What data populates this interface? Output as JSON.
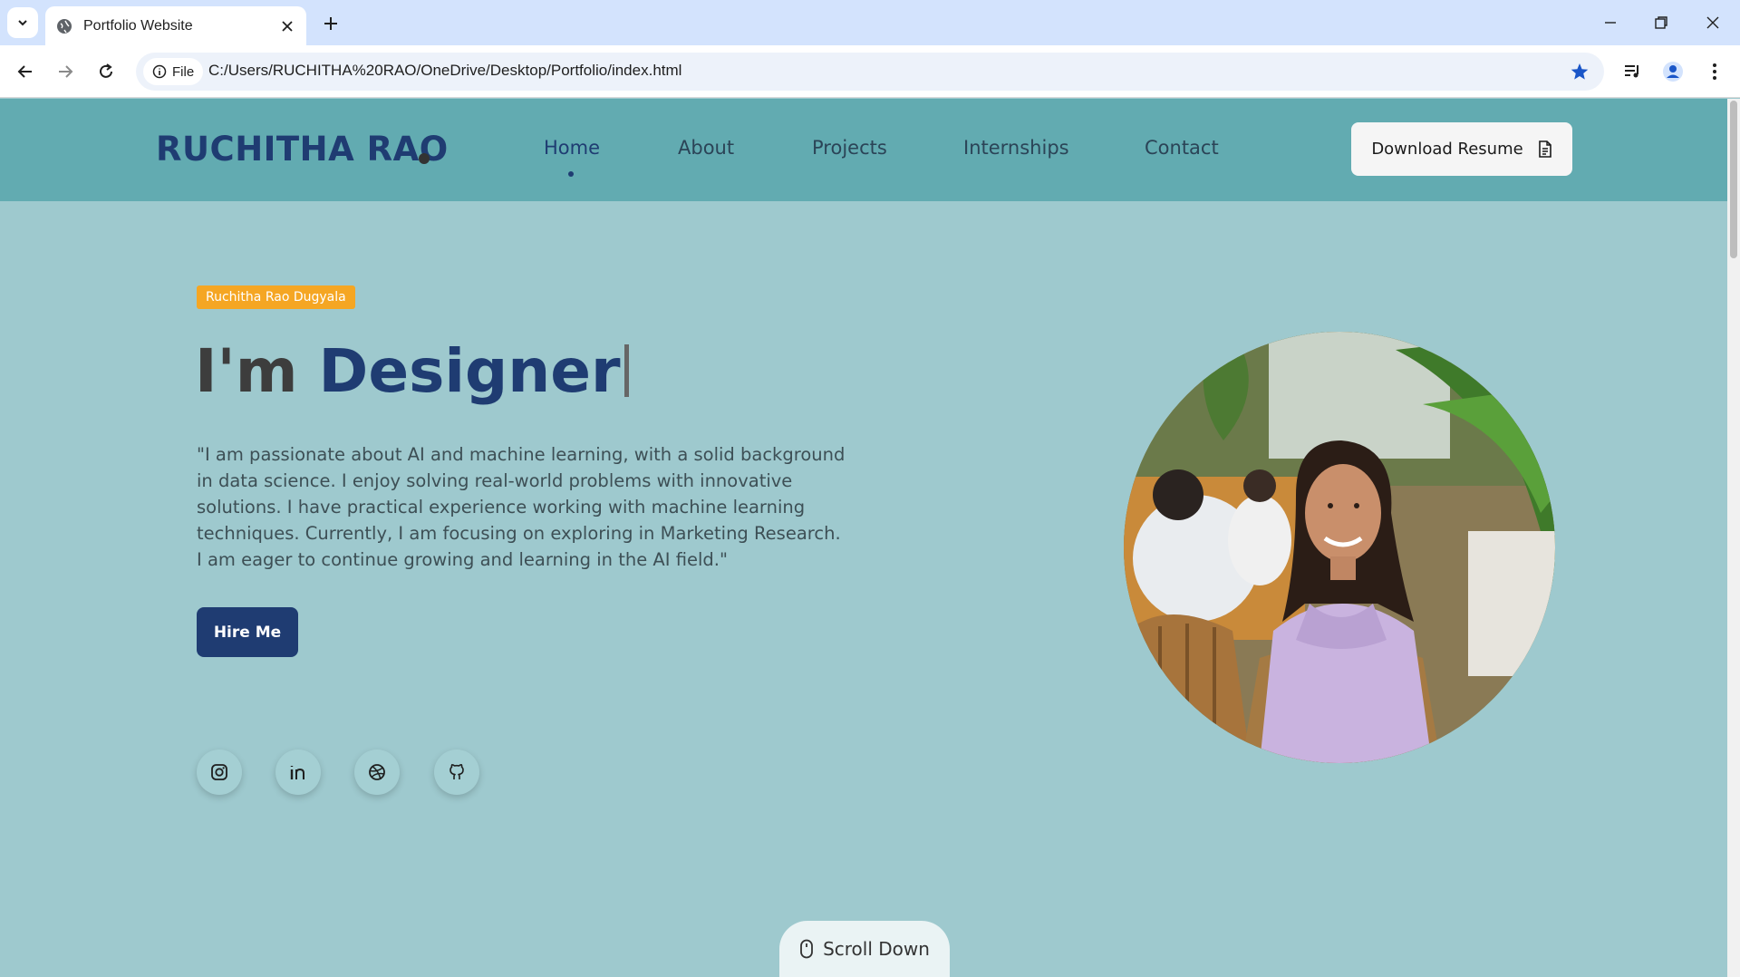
{
  "browser": {
    "tab_title": "Portfolio Website",
    "chip_label": "File",
    "url": "C:/Users/RUCHITHA%20RAO/OneDrive/Desktop/Portfolio/index.html"
  },
  "header": {
    "logo": "RUCHITHA RAO",
    "nav": [
      "Home",
      "About",
      "Projects",
      "Internships",
      "Contact"
    ],
    "active_nav": "Home",
    "resume_button": "Download Resume"
  },
  "hero": {
    "badge": "Ruchitha Rao Dugyala",
    "headline_prefix": "I'm",
    "headline_role": "Designer",
    "bio": "\"I am passionate about AI and machine learning, with a solid background in data science. I enjoy solving real-world problems with innovative solutions. I have practical experience working with machine learning techniques. Currently, I am focusing on exploring in Marketing Research. I am eager to continue growing and learning in the AI field.\"",
    "hire_button": "Hire Me",
    "socials": [
      "instagram-icon",
      "linkedin-icon",
      "dribbble-icon",
      "github-icon"
    ]
  },
  "scroll_down": "Scroll Down",
  "colors": {
    "header_bg": "#62abb1",
    "page_bg": "#9ec9ce",
    "accent": "#1f3c72",
    "badge": "#f5a623"
  }
}
